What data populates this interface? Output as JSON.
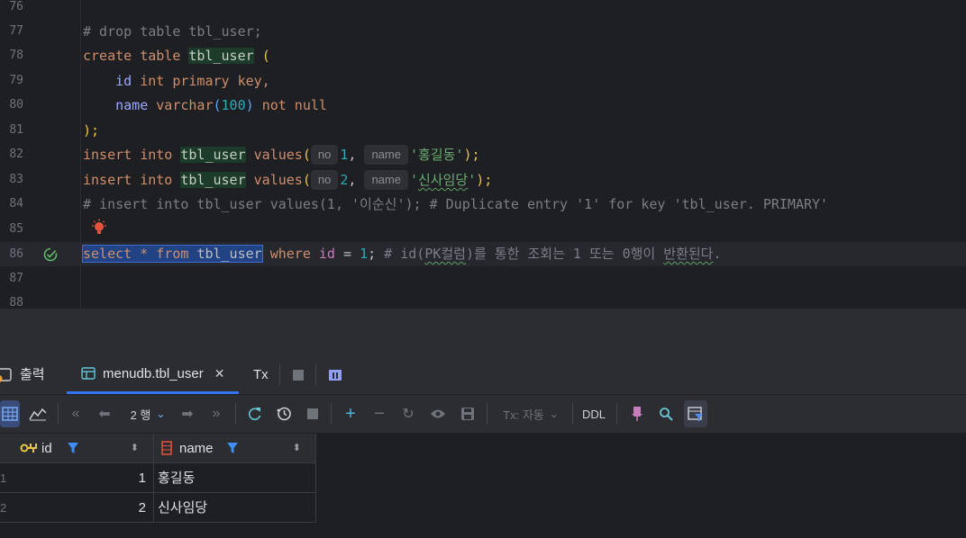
{
  "editor": {
    "line_numbers": [
      "76",
      "77",
      "78",
      "79",
      "80",
      "81",
      "82",
      "83",
      "84",
      "85",
      "86",
      "87",
      "88"
    ],
    "code": {
      "l77_comment": "# drop table tbl_user;",
      "create": "create",
      "table": "table",
      "tbl_user": "tbl_user",
      "paren_open": "(",
      "id": "id",
      "int": "int",
      "primary": "primary",
      "key": "key,",
      "name": "name",
      "varchar": "varchar",
      "varchar_open": "(",
      "len": "100",
      "varchar_close": ")",
      "not_null": "not null",
      "close": ");",
      "insert": "insert",
      "into": "into",
      "values": "values",
      "values_open": "(",
      "hint_no": "no",
      "hint_name": "name",
      "v1_num": "1",
      "v2_num": "2",
      "comma": ",",
      "v1_str": "'홍길동'",
      "v2_str_open": "'",
      "v2_str_body": "신사임당",
      "v2_str_close": "'",
      "end": ");",
      "l84_comment": "# insert into tbl_user values(1, '이순신'); # Duplicate entry '1' for key 'tbl_user. PRIMARY'",
      "select_sel": "select * from tbl_user",
      "where": "where",
      "eq": " = ",
      "one": "1",
      "semi": ";",
      "l86_c1": " # id(",
      "l86_c2": "PK컬럼",
      "l86_c3": ")를 통한 조회는 1 또는 0행이 ",
      "l86_c4": "반환된다",
      "l86_c5": "."
    }
  },
  "panel": {
    "tabs": [
      {
        "label": "출력"
      },
      {
        "label": "menudb.tbl_user"
      },
      {
        "label": "Tx"
      }
    ],
    "toolbar": {
      "rows_label": "2 행",
      "tx_label": "Tx: 자동",
      "ddl_label": "DDL"
    },
    "grid": {
      "columns": [
        "id",
        "name"
      ],
      "rows": [
        {
          "num": "1",
          "id": "1",
          "name": "홍길동"
        },
        {
          "num": "2",
          "id": "2",
          "name": "신사임당"
        }
      ]
    }
  },
  "colors": {
    "keyword": "#cf8e6d",
    "comment": "#7a7e85",
    "string": "#6aab73",
    "number": "#2aacb8",
    "accent": "#3574f0"
  }
}
